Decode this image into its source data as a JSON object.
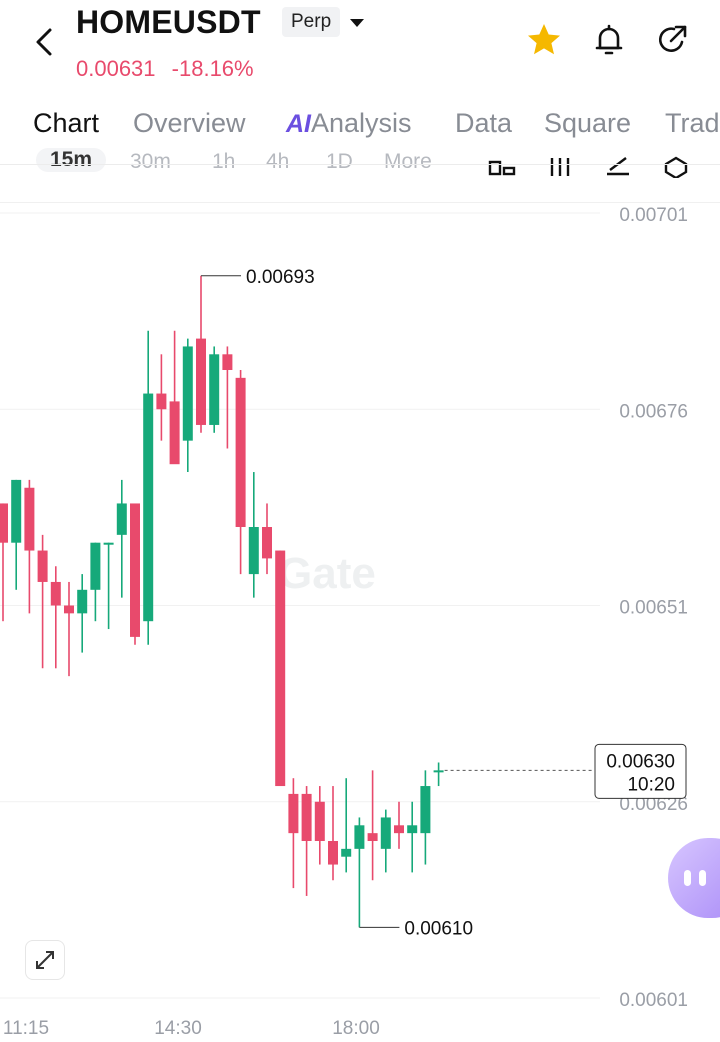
{
  "header": {
    "symbol": "HOMEUSDT",
    "badge": "Perp",
    "last_price": "0.00631",
    "change_pct": "-18.16%",
    "colors": {
      "down": "#e84a6c",
      "up": "#16a97a",
      "favorite": "#f5b800"
    },
    "icons": [
      "back-arrow-icon",
      "caret-down-icon",
      "star-icon",
      "bell-icon",
      "share-icon"
    ]
  },
  "tabs": {
    "chart": "Chart",
    "overview": "Overview",
    "ai_badge": "AI",
    "analysis": "Analysis",
    "data": "Data",
    "square": "Square",
    "trade": "Trad"
  },
  "intervals": [
    "15m",
    "30m",
    "1h",
    "4h",
    "1D",
    "More"
  ],
  "chart_data": {
    "type": "candlestick",
    "y_ticks": [
      "0.00701",
      "0.00676",
      "0.00651",
      "0.00626",
      "0.00601"
    ],
    "x_ticks": [
      "11:15",
      "14:30",
      "18:00"
    ],
    "high_marker": "0.00693",
    "low_marker": "0.00610",
    "current_price": "0.00630",
    "countdown": "10:20",
    "watermark": "Gate",
    "candles": [
      {
        "o": 0.00664,
        "h": 0.00664,
        "l": 0.00649,
        "c": 0.00659
      },
      {
        "o": 0.00659,
        "h": 0.00667,
        "l": 0.00653,
        "c": 0.00667
      },
      {
        "o": 0.00666,
        "h": 0.00667,
        "l": 0.0065,
        "c": 0.00658
      },
      {
        "o": 0.00658,
        "h": 0.0066,
        "l": 0.00643,
        "c": 0.00654
      },
      {
        "o": 0.00654,
        "h": 0.00656,
        "l": 0.00643,
        "c": 0.00651
      },
      {
        "o": 0.00651,
        "h": 0.00654,
        "l": 0.00642,
        "c": 0.0065
      },
      {
        "o": 0.0065,
        "h": 0.00655,
        "l": 0.00645,
        "c": 0.00653
      },
      {
        "o": 0.00653,
        "h": 0.00659,
        "l": 0.00649,
        "c": 0.00659
      },
      {
        "o": 0.00659,
        "h": 0.00659,
        "l": 0.00648,
        "c": 0.00659
      },
      {
        "o": 0.0066,
        "h": 0.00667,
        "l": 0.00652,
        "c": 0.00664
      },
      {
        "o": 0.00664,
        "h": 0.00664,
        "l": 0.00646,
        "c": 0.00647
      },
      {
        "o": 0.00649,
        "h": 0.00686,
        "l": 0.00646,
        "c": 0.00678
      },
      {
        "o": 0.00678,
        "h": 0.00683,
        "l": 0.00672,
        "c": 0.00676
      },
      {
        "o": 0.00677,
        "h": 0.00686,
        "l": 0.0067,
        "c": 0.00669
      },
      {
        "o": 0.00672,
        "h": 0.00685,
        "l": 0.00668,
        "c": 0.00684
      },
      {
        "o": 0.00685,
        "h": 0.00693,
        "l": 0.00673,
        "c": 0.00674
      },
      {
        "o": 0.00674,
        "h": 0.00684,
        "l": 0.00673,
        "c": 0.00683
      },
      {
        "o": 0.00683,
        "h": 0.00684,
        "l": 0.00671,
        "c": 0.00681
      },
      {
        "o": 0.0068,
        "h": 0.00681,
        "l": 0.00655,
        "c": 0.00661
      },
      {
        "o": 0.00655,
        "h": 0.00668,
        "l": 0.00652,
        "c": 0.00661
      },
      {
        "o": 0.00661,
        "h": 0.00664,
        "l": 0.00655,
        "c": 0.00657
      },
      {
        "o": 0.00658,
        "h": 0.00658,
        "l": 0.00628,
        "c": 0.00628
      },
      {
        "o": 0.00627,
        "h": 0.00629,
        "l": 0.00615,
        "c": 0.00622
      },
      {
        "o": 0.00627,
        "h": 0.00628,
        "l": 0.00614,
        "c": 0.00621
      },
      {
        "o": 0.00626,
        "h": 0.00628,
        "l": 0.00618,
        "c": 0.00621
      },
      {
        "o": 0.00621,
        "h": 0.00628,
        "l": 0.00616,
        "c": 0.00618
      },
      {
        "o": 0.00619,
        "h": 0.00629,
        "l": 0.00617,
        "c": 0.0062
      },
      {
        "o": 0.0062,
        "h": 0.00624,
        "l": 0.0061,
        "c": 0.00623
      },
      {
        "o": 0.00622,
        "h": 0.0063,
        "l": 0.00616,
        "c": 0.00621
      },
      {
        "o": 0.0062,
        "h": 0.00625,
        "l": 0.00617,
        "c": 0.00624
      },
      {
        "o": 0.00623,
        "h": 0.00626,
        "l": 0.0062,
        "c": 0.00622
      },
      {
        "o": 0.00622,
        "h": 0.00626,
        "l": 0.00617,
        "c": 0.00623
      },
      {
        "o": 0.00622,
        "h": 0.0063,
        "l": 0.00618,
        "c": 0.00628
      },
      {
        "o": 0.0063,
        "h": 0.00631,
        "l": 0.00628,
        "c": 0.0063
      }
    ]
  }
}
